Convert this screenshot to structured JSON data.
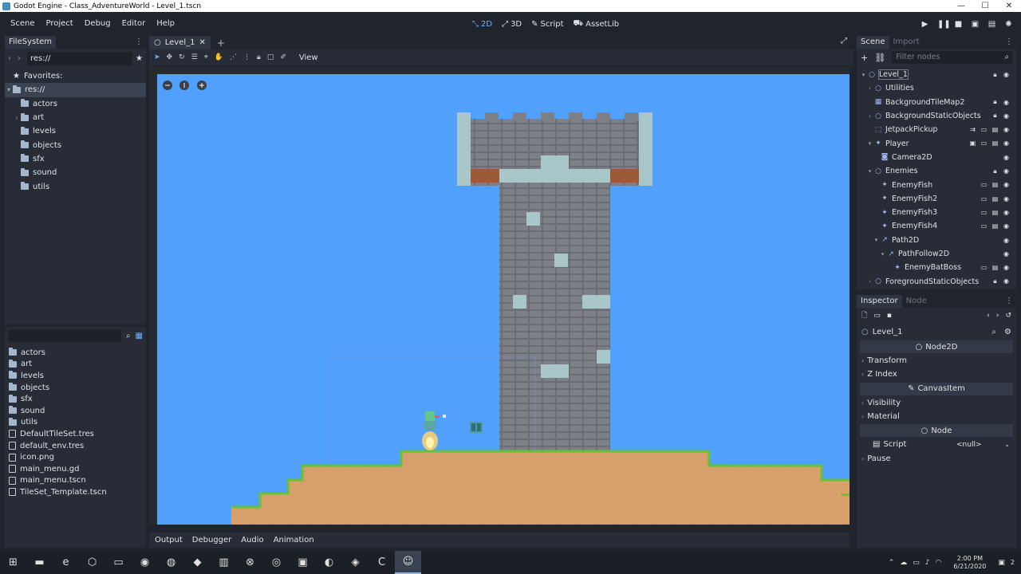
{
  "window": {
    "title": "Godot Engine - Class_AdventureWorld - Level_1.tscn",
    "controls": [
      "—",
      "☐",
      "✕"
    ]
  },
  "menu": {
    "items": [
      "Scene",
      "Project",
      "Debug",
      "Editor",
      "Help"
    ],
    "main_screens": [
      {
        "label": "2D",
        "icon": "2d-icon",
        "active": true
      },
      {
        "label": "3D",
        "icon": "3d-icon",
        "active": false
      },
      {
        "label": "Script",
        "icon": "script-icon",
        "active": false
      },
      {
        "label": "AssetLib",
        "icon": "assetlib-icon",
        "active": false
      }
    ]
  },
  "filesystem": {
    "tab": "FileSystem",
    "path": "res://",
    "favorites_label": "Favorites:",
    "root": "res://",
    "folders": [
      "actors",
      "art",
      "levels",
      "objects",
      "sfx",
      "sound",
      "utils"
    ],
    "files": [
      {
        "name": "actors",
        "kind": "folder"
      },
      {
        "name": "art",
        "kind": "folder"
      },
      {
        "name": "levels",
        "kind": "folder"
      },
      {
        "name": "objects",
        "kind": "folder"
      },
      {
        "name": "sfx",
        "kind": "folder"
      },
      {
        "name": "sound",
        "kind": "folder"
      },
      {
        "name": "utils",
        "kind": "folder"
      },
      {
        "name": "DefaultTileSet.tres",
        "kind": "file"
      },
      {
        "name": "default_env.tres",
        "kind": "file"
      },
      {
        "name": "icon.png",
        "kind": "file"
      },
      {
        "name": "main_menu.gd",
        "kind": "file"
      },
      {
        "name": "main_menu.tscn",
        "kind": "file"
      },
      {
        "name": "TileSet_Template.tscn",
        "kind": "file"
      }
    ]
  },
  "editor": {
    "scene_tab": "Level_1",
    "view_menu": "View",
    "bottom_tabs": [
      "Output",
      "Debugger",
      "Audio",
      "Animation"
    ],
    "sky_color": "#50a0fc"
  },
  "scene": {
    "tabs": [
      "Scene",
      "Import"
    ],
    "filter_placeholder": "Filter nodes",
    "nodes": [
      {
        "name": "Level_1",
        "depth": 0,
        "arrow": "▾",
        "icon": "node2d-icon",
        "sel": true,
        "badges": [
          "lock-icon",
          "eye-icon"
        ]
      },
      {
        "name": "Utilities",
        "depth": 1,
        "arrow": "›",
        "icon": "node2d-icon",
        "badges": []
      },
      {
        "name": "BackgroundTileMap2",
        "depth": 1,
        "arrow": "",
        "icon": "tilemap-icon",
        "badges": [
          "lock-icon",
          "eye-icon"
        ]
      },
      {
        "name": "BackgroundStaticObjects",
        "depth": 1,
        "arrow": "›",
        "icon": "node2d-icon",
        "badges": [
          "lock-icon",
          "eye-icon"
        ]
      },
      {
        "name": "JetpackPickup",
        "depth": 1,
        "arrow": "",
        "icon": "area2d-icon",
        "badges": [
          "signal-icon",
          "instance-icon",
          "script-icon",
          "eye-icon"
        ]
      },
      {
        "name": "Player",
        "depth": 1,
        "arrow": "▾",
        "icon": "kinematic-icon",
        "badges": [
          "group-icon",
          "instance-icon",
          "script-icon",
          "eye-icon"
        ]
      },
      {
        "name": "Camera2D",
        "depth": 2,
        "arrow": "",
        "icon": "camera-icon",
        "badges": [
          "eye-icon"
        ]
      },
      {
        "name": "Enemies",
        "depth": 1,
        "arrow": "▾",
        "icon": "node2d-icon",
        "badges": [
          "lock-icon",
          "eye-icon"
        ]
      },
      {
        "name": "EnemyFish",
        "depth": 2,
        "arrow": "",
        "icon": "kinematic-icon",
        "badges": [
          "instance-icon",
          "script-icon",
          "eye-icon"
        ]
      },
      {
        "name": "EnemyFish2",
        "depth": 2,
        "arrow": "",
        "icon": "kinematic-icon",
        "badges": [
          "instance-icon",
          "script-icon",
          "eye-icon"
        ]
      },
      {
        "name": "EnemyFish3",
        "depth": 2,
        "arrow": "",
        "icon": "kinematic-icon",
        "badges": [
          "instance-icon",
          "script-icon",
          "eye-icon"
        ]
      },
      {
        "name": "EnemyFish4",
        "depth": 2,
        "arrow": "",
        "icon": "kinematic-icon",
        "badges": [
          "instance-icon",
          "script-icon",
          "eye-icon"
        ]
      },
      {
        "name": "Path2D",
        "depth": 2,
        "arrow": "▾",
        "icon": "path-icon",
        "badges": [
          "eye-icon"
        ]
      },
      {
        "name": "PathFollow2D",
        "depth": 3,
        "arrow": "▾",
        "icon": "path-icon",
        "badges": [
          "eye-icon"
        ]
      },
      {
        "name": "EnemyBatBoss",
        "depth": 4,
        "arrow": "",
        "icon": "kinematic-icon",
        "badges": [
          "instance-icon",
          "script-icon",
          "eye-icon"
        ]
      },
      {
        "name": "ForegroundStaticObjects",
        "depth": 1,
        "arrow": "›",
        "icon": "node2d-icon",
        "badges": [
          "lock-icon",
          "eye-icon"
        ]
      }
    ]
  },
  "inspector": {
    "tabs": [
      "Inspector",
      "Node"
    ],
    "object_name": "Level_1",
    "sections": {
      "node2d": "Node2D",
      "canvas_item": "CanvasItem",
      "node": "Node"
    },
    "node2d_groups": [
      "Transform",
      "Z Index"
    ],
    "canvas_groups": [
      "Visibility",
      "Material"
    ],
    "script_label": "Script",
    "script_value": "<null>",
    "pause_group": "Pause"
  },
  "taskbar": {
    "time": "2:00 PM",
    "date": "6/21/2020",
    "notifications": "2"
  }
}
